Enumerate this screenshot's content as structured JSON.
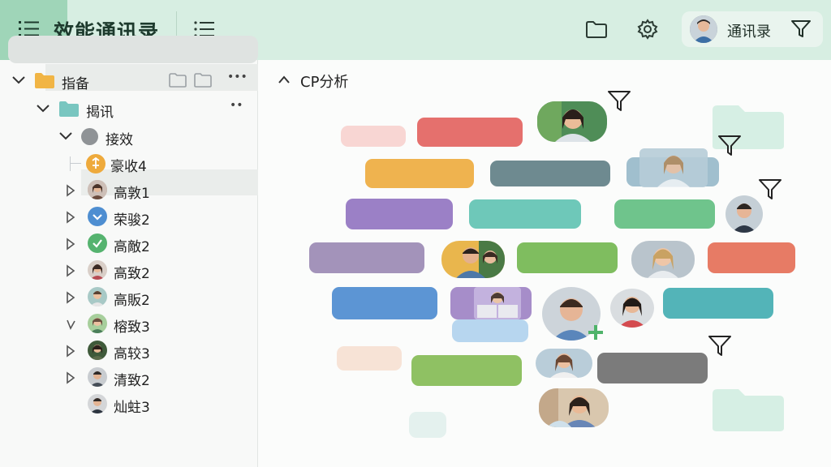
{
  "header": {
    "title": "效能通讯录",
    "contacts_label": "通讯录"
  },
  "sidebar": {
    "root": {
      "label": "指备",
      "more": "•••"
    },
    "group": {
      "label": "揭讯",
      "more": "••"
    },
    "subgroup": {
      "label": "接效"
    },
    "items": [
      {
        "label": "豪收4"
      },
      {
        "label": "高敦1"
      },
      {
        "label": "荣骏2"
      },
      {
        "label": "高敵2"
      },
      {
        "label": "高致2"
      },
      {
        "label": "高販2"
      },
      {
        "label": "榕致3"
      },
      {
        "label": "高较3"
      },
      {
        "label": "清致2"
      },
      {
        "label": "灿蛀3"
      }
    ]
  },
  "main": {
    "section_title": "CP分析"
  },
  "colors": {
    "header_bg": "#d7eee2",
    "accent_green": "#9fd5b8",
    "pill_red": "#e5706d",
    "pill_orange": "#efb34f",
    "pill_slate": "#6e8a90",
    "pill_purple": "#9b80c6",
    "pill_teal": "#6ec8b9",
    "pill_green": "#6fc48c",
    "pill_mauve": "#a393ba",
    "pill_leaf": "#7fbd5f",
    "pill_coral": "#e77b65",
    "pill_blue": "#5c95d4",
    "pill_sea": "#53b4b8",
    "pill_olive": "#8fc163",
    "pill_gray": "#7b7b7b"
  },
  "icons": [
    "list-icon",
    "folder-icon",
    "gear-icon",
    "filter-icon",
    "chevron-down-icon",
    "chevron-right-icon",
    "chevron-up-icon",
    "avatar"
  ]
}
